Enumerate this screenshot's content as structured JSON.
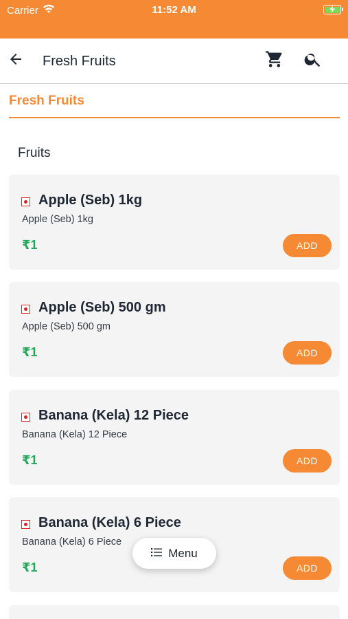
{
  "status_bar": {
    "carrier": "Carrier",
    "time": "11:52 AM",
    "wifi_icon": "wifi-icon",
    "battery_icon": "battery-charging-icon"
  },
  "app_bar": {
    "title": "Fresh Fruits",
    "back_icon": "arrow-left-icon",
    "cart_icon": "cart-icon",
    "search_icon": "search-icon"
  },
  "section": {
    "title": "Fresh Fruits",
    "category": "Fruits"
  },
  "products": [
    {
      "name": "Apple (Seb) 1kg",
      "description": "Apple (Seb) 1kg",
      "price": "₹1",
      "add_label": "ADD"
    },
    {
      "name": "Apple (Seb) 500 gm",
      "description": "Apple (Seb) 500 gm",
      "price": "₹1",
      "add_label": "ADD"
    },
    {
      "name": "Banana (Kela) 12 Piece",
      "description": "Banana (Kela) 12 Piece",
      "price": "₹1",
      "add_label": "ADD"
    },
    {
      "name": "Banana (Kela) 6 Piece",
      "description": "Banana (Kela) 6 Piece",
      "price": "₹1",
      "add_label": "ADD"
    }
  ],
  "menu_button": {
    "label": "Menu",
    "icon": "list-icon"
  },
  "colors": {
    "accent": "#f68a34",
    "price_green": "#23a85a",
    "card_bg": "#f4f4f4",
    "badge_red": "#e02020"
  }
}
